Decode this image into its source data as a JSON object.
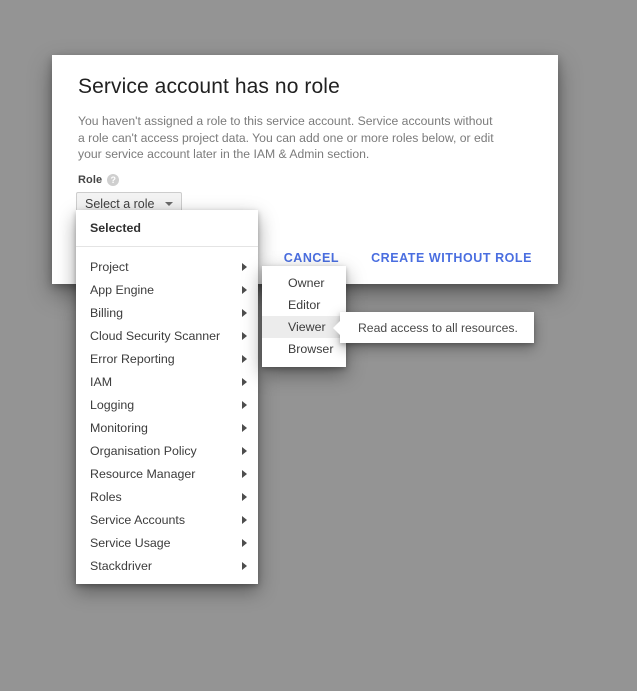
{
  "colors": {
    "page_background": "#949494",
    "accent_blue": "#4a6ee0",
    "surface": "#ffffff",
    "body_text": "#7b7b7b"
  },
  "dialog": {
    "title": "Service account has no role",
    "body": "You haven't assigned a role to this service account. Service accounts without a role can't access project data. You can add one or more roles below, or edit your service account later in the IAM & Admin section.",
    "role_field": {
      "label": "Role",
      "help_icon_glyph": "?",
      "select_value": "Select a role"
    },
    "actions": [
      {
        "label": "CANCEL",
        "name": "cancel-button"
      },
      {
        "label": "CREATE WITHOUT ROLE",
        "name": "create-without-role-button"
      }
    ]
  },
  "role_menu": {
    "header": "Selected",
    "items": [
      {
        "label": "Project"
      },
      {
        "label": "App Engine"
      },
      {
        "label": "Billing"
      },
      {
        "label": "Cloud Security Scanner"
      },
      {
        "label": "Error Reporting"
      },
      {
        "label": "IAM"
      },
      {
        "label": "Logging"
      },
      {
        "label": "Monitoring"
      },
      {
        "label": "Organisation Policy"
      },
      {
        "label": "Resource Manager"
      },
      {
        "label": "Roles"
      },
      {
        "label": "Service Accounts"
      },
      {
        "label": "Service Usage"
      },
      {
        "label": "Stackdriver"
      }
    ]
  },
  "role_submenu": {
    "items": [
      {
        "label": "Owner",
        "active": false
      },
      {
        "label": "Editor",
        "active": false
      },
      {
        "label": "Viewer",
        "active": true
      },
      {
        "label": "Browser",
        "active": false
      }
    ]
  },
  "tooltip": {
    "text": "Read access to all resources."
  }
}
